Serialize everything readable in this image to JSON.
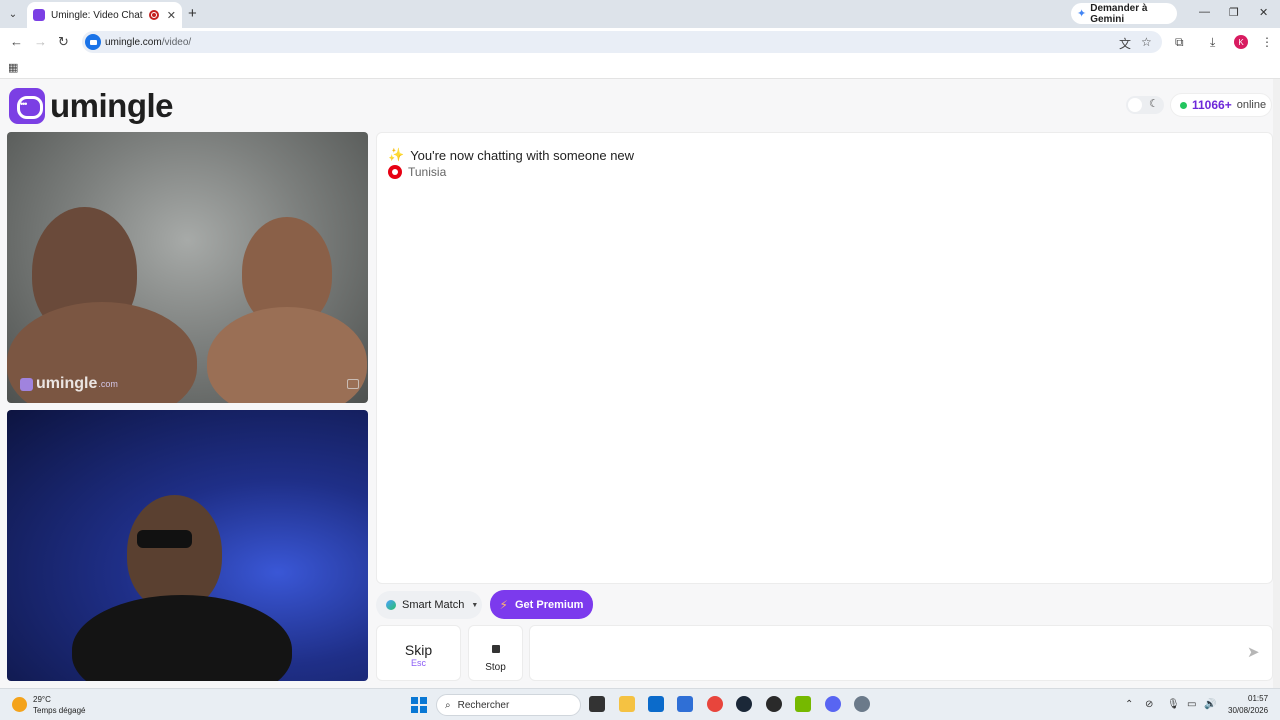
{
  "browser": {
    "tab_title": "Umingle: Video Chat with S",
    "gemini_label": "Demander à Gemini",
    "url_host": "umingle.com",
    "url_path": "/video/"
  },
  "header": {
    "logo_text": "umingle",
    "online_count": "11066+",
    "online_label": "online"
  },
  "video": {
    "watermark_text": "umingle",
    "watermark_suffix": ".com"
  },
  "chat": {
    "status_message": "You're now chatting with someone new",
    "partner_country": "Tunisia",
    "message_placeholder": ""
  },
  "controls": {
    "smart_match_label": "Smart Match",
    "premium_label": "Get Premium",
    "skip_label": "Skip",
    "skip_shortcut": "Esc",
    "stop_label": "Stop"
  },
  "taskbar": {
    "weather_temp": "29°C",
    "weather_desc": "Temps dégagé",
    "search_label": "Rechercher",
    "time": "01:57",
    "date": "30/08/2026"
  },
  "colors": {
    "brand": "#7c3aed",
    "online_dot": "#22c55e"
  }
}
